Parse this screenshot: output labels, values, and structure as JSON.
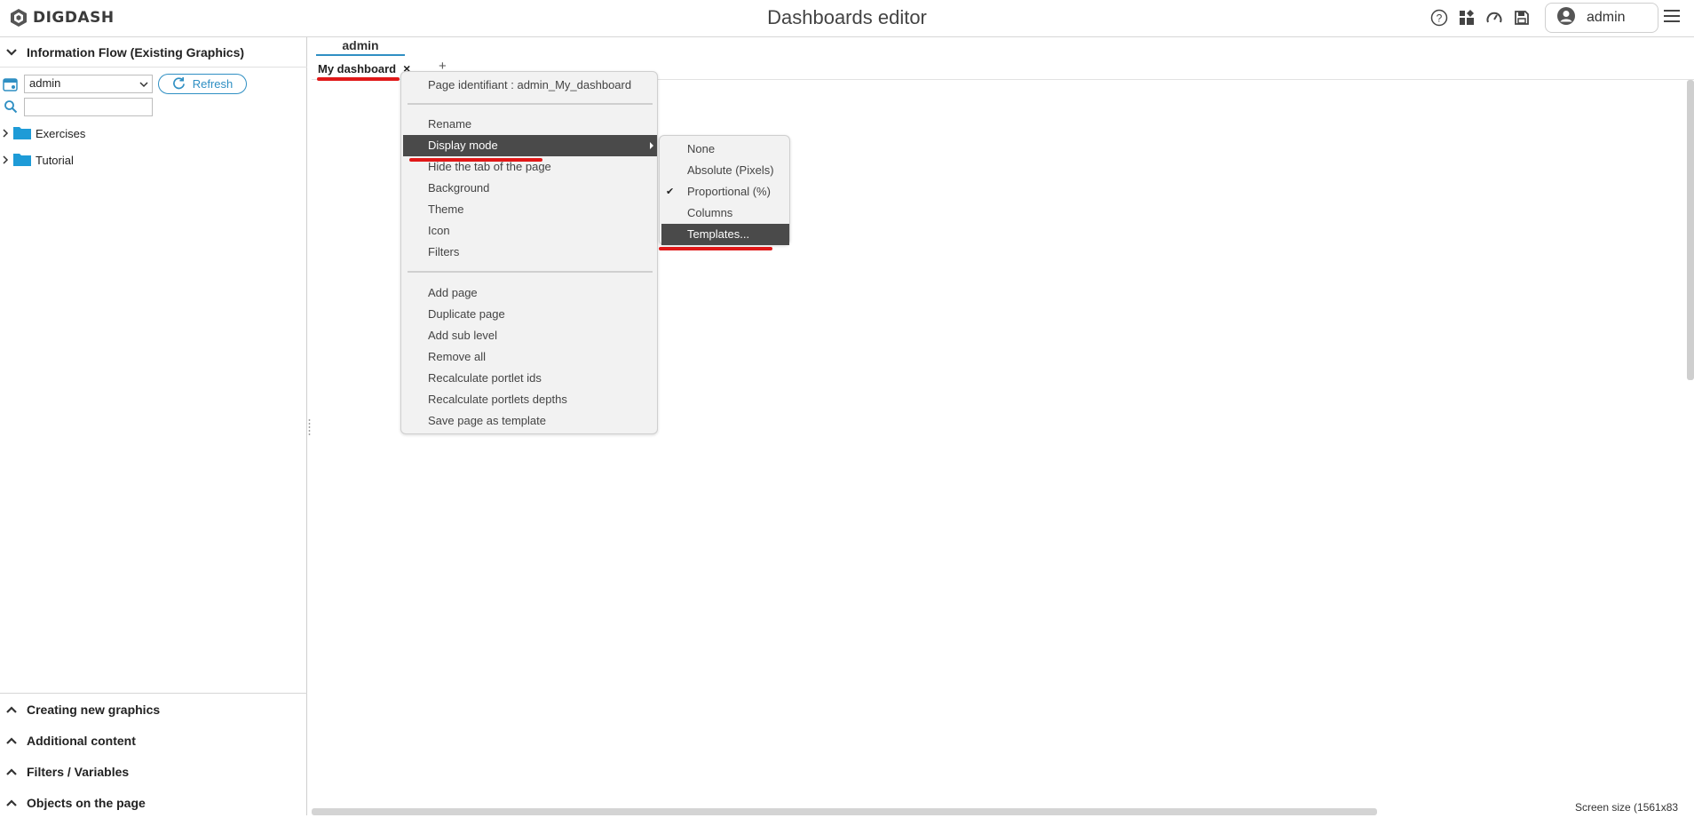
{
  "app": {
    "logo_text": "DIGDASH",
    "title": "Dashboards editor",
    "user": "admin",
    "icons": [
      "help-icon",
      "widgets-icon",
      "gauge-icon",
      "save-icon",
      "user-avatar-icon",
      "menu-icon"
    ]
  },
  "left_panel": {
    "flow_section": "Information Flow (Existing Graphics)",
    "select_value": "admin",
    "refresh_label": "Refresh",
    "search_value": "",
    "tree": [
      {
        "label": "Exercises"
      },
      {
        "label": "Tutorial"
      }
    ],
    "bottom_sections": [
      {
        "label": "Creating new graphics"
      },
      {
        "label": "Additional content"
      },
      {
        "label": "Filters / Variables"
      },
      {
        "label": "Objects on the page"
      }
    ]
  },
  "tabs": {
    "level_tab": "admin",
    "page_tab": "My dashboard",
    "close_glyph": "×",
    "add_glyph": "+"
  },
  "context_menu": {
    "page_identifier": "Page identifiant : admin_My_dashboard",
    "group1": [
      "Rename",
      "Display mode",
      "Hide the tab of the page",
      "Background",
      "Theme",
      "Icon",
      "Filters"
    ],
    "group2": [
      "Add page",
      "Duplicate page",
      "Add sub level",
      "Remove all",
      "Recalculate portlet ids",
      "Recalculate portlets depths",
      "Save page as template"
    ],
    "active_item": "Display mode"
  },
  "display_mode_submenu": {
    "items": [
      "None",
      "Absolute (Pixels)",
      "Proportional (%)",
      "Columns",
      "Templates..."
    ],
    "checked": "Proportional (%)",
    "highlighted": "Templates...",
    "check_glyph": "✔"
  },
  "footer": {
    "screen_size": "Screen size (1561x83"
  },
  "colors": {
    "accent": "#2f8fc3",
    "menu_highlight": "#4a4a4a",
    "annotation_red": "#e01818",
    "folder_blue": "#1e9bd7"
  }
}
